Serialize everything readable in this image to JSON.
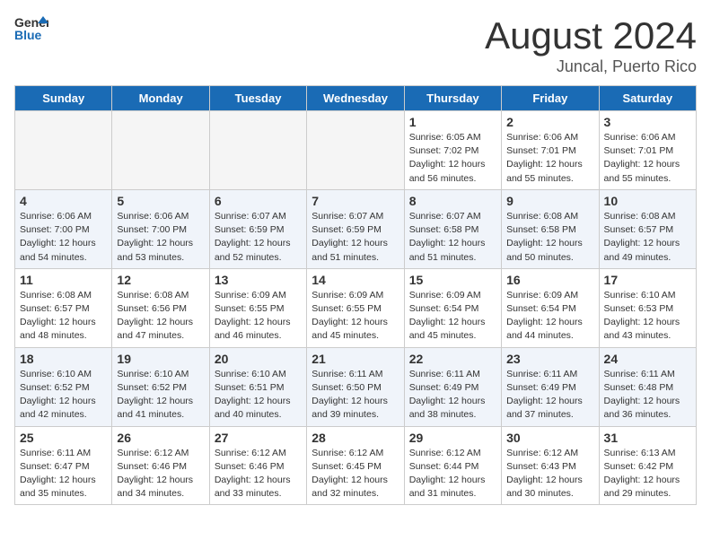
{
  "header": {
    "logo_general": "General",
    "logo_blue": "Blue",
    "month": "August 2024",
    "location": "Juncal, Puerto Rico"
  },
  "weekdays": [
    "Sunday",
    "Monday",
    "Tuesday",
    "Wednesday",
    "Thursday",
    "Friday",
    "Saturday"
  ],
  "weeks": [
    [
      {
        "day": "",
        "info": ""
      },
      {
        "day": "",
        "info": ""
      },
      {
        "day": "",
        "info": ""
      },
      {
        "day": "",
        "info": ""
      },
      {
        "day": "1",
        "info": "Sunrise: 6:05 AM\nSunset: 7:02 PM\nDaylight: 12 hours\nand 56 minutes."
      },
      {
        "day": "2",
        "info": "Sunrise: 6:06 AM\nSunset: 7:01 PM\nDaylight: 12 hours\nand 55 minutes."
      },
      {
        "day": "3",
        "info": "Sunrise: 6:06 AM\nSunset: 7:01 PM\nDaylight: 12 hours\nand 55 minutes."
      }
    ],
    [
      {
        "day": "4",
        "info": "Sunrise: 6:06 AM\nSunset: 7:00 PM\nDaylight: 12 hours\nand 54 minutes."
      },
      {
        "day": "5",
        "info": "Sunrise: 6:06 AM\nSunset: 7:00 PM\nDaylight: 12 hours\nand 53 minutes."
      },
      {
        "day": "6",
        "info": "Sunrise: 6:07 AM\nSunset: 6:59 PM\nDaylight: 12 hours\nand 52 minutes."
      },
      {
        "day": "7",
        "info": "Sunrise: 6:07 AM\nSunset: 6:59 PM\nDaylight: 12 hours\nand 51 minutes."
      },
      {
        "day": "8",
        "info": "Sunrise: 6:07 AM\nSunset: 6:58 PM\nDaylight: 12 hours\nand 51 minutes."
      },
      {
        "day": "9",
        "info": "Sunrise: 6:08 AM\nSunset: 6:58 PM\nDaylight: 12 hours\nand 50 minutes."
      },
      {
        "day": "10",
        "info": "Sunrise: 6:08 AM\nSunset: 6:57 PM\nDaylight: 12 hours\nand 49 minutes."
      }
    ],
    [
      {
        "day": "11",
        "info": "Sunrise: 6:08 AM\nSunset: 6:57 PM\nDaylight: 12 hours\nand 48 minutes."
      },
      {
        "day": "12",
        "info": "Sunrise: 6:08 AM\nSunset: 6:56 PM\nDaylight: 12 hours\nand 47 minutes."
      },
      {
        "day": "13",
        "info": "Sunrise: 6:09 AM\nSunset: 6:55 PM\nDaylight: 12 hours\nand 46 minutes."
      },
      {
        "day": "14",
        "info": "Sunrise: 6:09 AM\nSunset: 6:55 PM\nDaylight: 12 hours\nand 45 minutes."
      },
      {
        "day": "15",
        "info": "Sunrise: 6:09 AM\nSunset: 6:54 PM\nDaylight: 12 hours\nand 45 minutes."
      },
      {
        "day": "16",
        "info": "Sunrise: 6:09 AM\nSunset: 6:54 PM\nDaylight: 12 hours\nand 44 minutes."
      },
      {
        "day": "17",
        "info": "Sunrise: 6:10 AM\nSunset: 6:53 PM\nDaylight: 12 hours\nand 43 minutes."
      }
    ],
    [
      {
        "day": "18",
        "info": "Sunrise: 6:10 AM\nSunset: 6:52 PM\nDaylight: 12 hours\nand 42 minutes."
      },
      {
        "day": "19",
        "info": "Sunrise: 6:10 AM\nSunset: 6:52 PM\nDaylight: 12 hours\nand 41 minutes."
      },
      {
        "day": "20",
        "info": "Sunrise: 6:10 AM\nSunset: 6:51 PM\nDaylight: 12 hours\nand 40 minutes."
      },
      {
        "day": "21",
        "info": "Sunrise: 6:11 AM\nSunset: 6:50 PM\nDaylight: 12 hours\nand 39 minutes."
      },
      {
        "day": "22",
        "info": "Sunrise: 6:11 AM\nSunset: 6:49 PM\nDaylight: 12 hours\nand 38 minutes."
      },
      {
        "day": "23",
        "info": "Sunrise: 6:11 AM\nSunset: 6:49 PM\nDaylight: 12 hours\nand 37 minutes."
      },
      {
        "day": "24",
        "info": "Sunrise: 6:11 AM\nSunset: 6:48 PM\nDaylight: 12 hours\nand 36 minutes."
      }
    ],
    [
      {
        "day": "25",
        "info": "Sunrise: 6:11 AM\nSunset: 6:47 PM\nDaylight: 12 hours\nand 35 minutes."
      },
      {
        "day": "26",
        "info": "Sunrise: 6:12 AM\nSunset: 6:46 PM\nDaylight: 12 hours\nand 34 minutes."
      },
      {
        "day": "27",
        "info": "Sunrise: 6:12 AM\nSunset: 6:46 PM\nDaylight: 12 hours\nand 33 minutes."
      },
      {
        "day": "28",
        "info": "Sunrise: 6:12 AM\nSunset: 6:45 PM\nDaylight: 12 hours\nand 32 minutes."
      },
      {
        "day": "29",
        "info": "Sunrise: 6:12 AM\nSunset: 6:44 PM\nDaylight: 12 hours\nand 31 minutes."
      },
      {
        "day": "30",
        "info": "Sunrise: 6:12 AM\nSunset: 6:43 PM\nDaylight: 12 hours\nand 30 minutes."
      },
      {
        "day": "31",
        "info": "Sunrise: 6:13 AM\nSunset: 6:42 PM\nDaylight: 12 hours\nand 29 minutes."
      }
    ]
  ]
}
